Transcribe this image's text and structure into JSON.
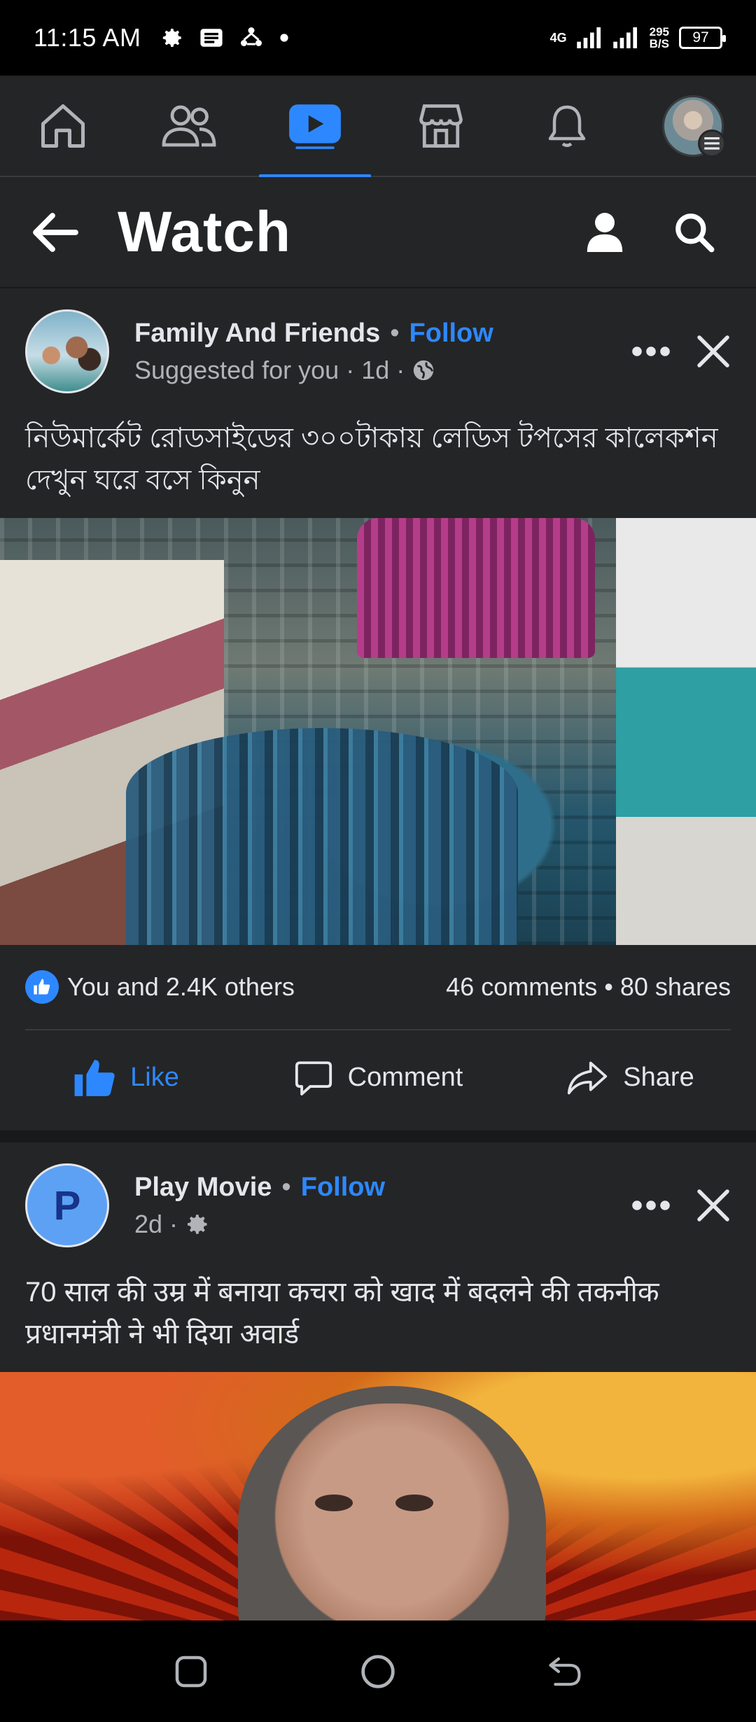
{
  "status_bar": {
    "time": "11:15 AM",
    "network_4g": "4G",
    "speed_value": "295",
    "speed_unit": "B/S",
    "battery": "97"
  },
  "top_nav": {
    "items": [
      {
        "icon": "home-icon"
      },
      {
        "icon": "friends-icon"
      },
      {
        "icon": "watch-icon",
        "active": true
      },
      {
        "icon": "marketplace-icon"
      },
      {
        "icon": "bell-icon"
      },
      {
        "icon": "profile-avatar"
      }
    ],
    "accent": "#2d88ff"
  },
  "watch_header": {
    "title": "Watch"
  },
  "posts": [
    {
      "author": "Family And Friends",
      "follow_label": "Follow",
      "subtitle": "Suggested for you",
      "time": "1d",
      "privacy_icon": "globe-icon",
      "text": "নিউমার্কেট রোডসাইডের ৩০০টাকায় লেডিস টপসের কালেকশন দেখুন ঘরে বসে কিনুন",
      "reactions": "You and 2.4K others",
      "comments": "46 comments",
      "shares": "80 shares",
      "actions": {
        "like": "Like",
        "comment": "Comment",
        "share": "Share"
      }
    },
    {
      "author": "Play Movie",
      "avatar_letter": "P",
      "follow_label": "Follow",
      "time": "2d",
      "privacy_icon": "gear-icon",
      "text": "70 साल की उम्र में बनाया कचरा को खाद में बदलने की तकनीक प्रधानमंत्री ने भी दिया अवार्ड"
    }
  ]
}
